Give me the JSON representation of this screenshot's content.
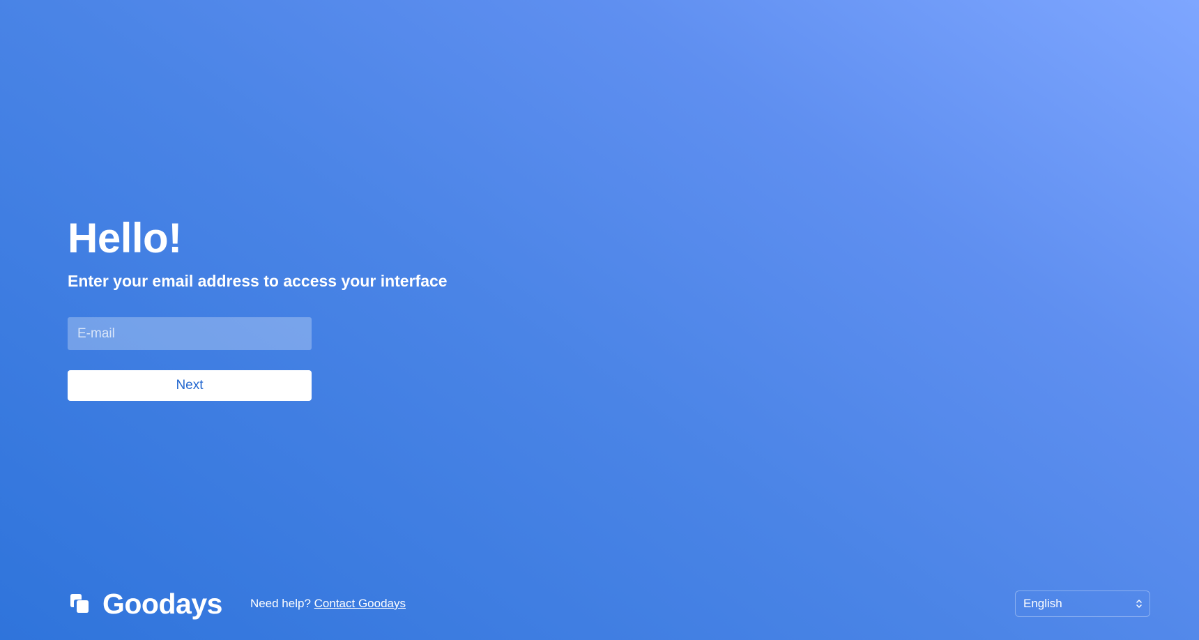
{
  "login": {
    "title": "Hello!",
    "subtitle": "Enter your email address to access your interface",
    "email_placeholder": "E-mail",
    "email_value": "",
    "next_label": "Next"
  },
  "footer": {
    "brand": "Goodays",
    "logo_icon": "goodays-logo-icon",
    "help_text": "Need help?",
    "help_link": "Contact Goodays",
    "language": "English"
  },
  "colors": {
    "background_start": "#7ea6ff",
    "background_end": "#2f74db",
    "button_text": "#2367cf",
    "button_bg": "#ffffff"
  }
}
